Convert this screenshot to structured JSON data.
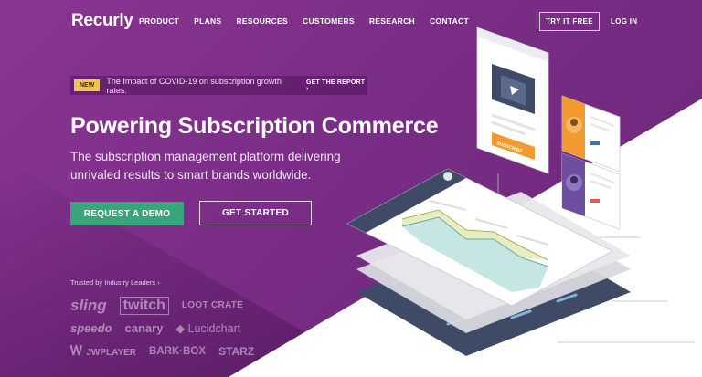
{
  "brand": {
    "logo": "Recurly"
  },
  "nav": {
    "links": [
      "PRODUCT",
      "PLANS",
      "RESOURCES",
      "CUSTOMERS",
      "RESEARCH",
      "CONTACT"
    ],
    "try_label": "TRY IT FREE",
    "login_label": "LOG IN"
  },
  "announcement": {
    "badge": "NEW",
    "text": "The Impact of COVID-19 on subscription growth rates.",
    "link": "GET THE REPORT"
  },
  "hero": {
    "headline": "Powering Subscription Commerce",
    "subline": "The subscription management platform delivering unrivaled results to smart brands worldwide.",
    "demo_label": "REQUEST A DEMO",
    "start_label": "GET STARTED"
  },
  "trusted": {
    "label": "Trusted by Industry Leaders",
    "logos": [
      "sling",
      "twitch",
      "LOOT CRATE",
      "speedo",
      "canary",
      "Lucidchart",
      "JWPLAYER",
      "BARK·BOX",
      "STARZ"
    ]
  },
  "illustration": {
    "subscribe_label": "SUBSCRIBE"
  },
  "colors": {
    "hero_purple": "#7b2f86",
    "demo_green": "#3aa57a",
    "badge_yellow": "#f0c64a",
    "card_orange": "#f29a2e",
    "card_violet": "#6c4fa0"
  }
}
